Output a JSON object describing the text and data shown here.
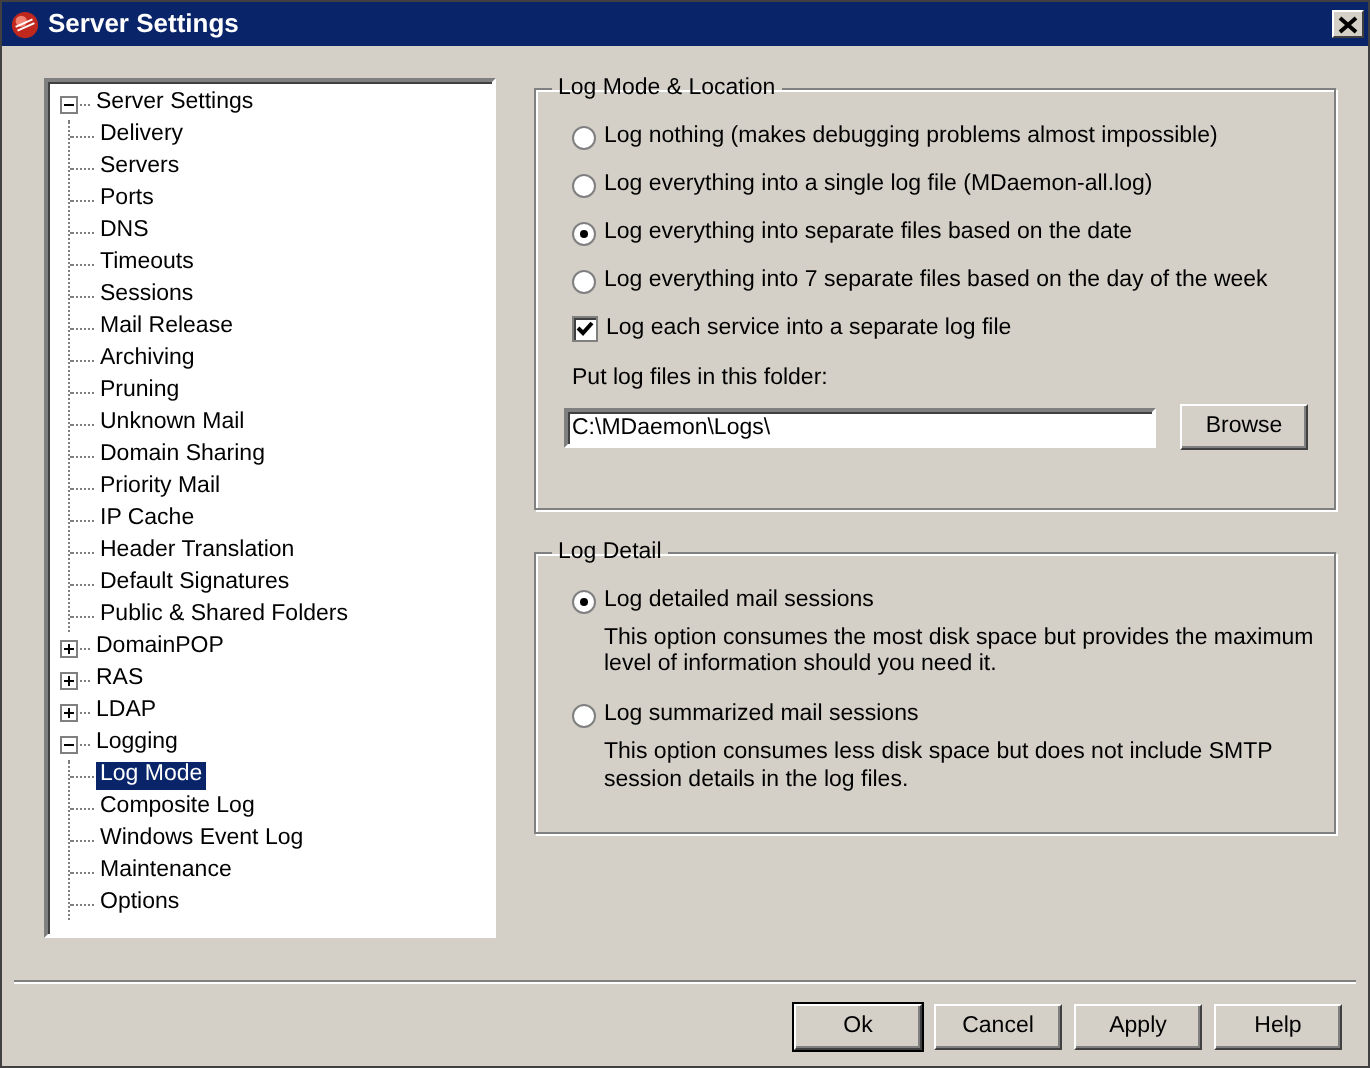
{
  "window": {
    "title": "Server Settings"
  },
  "tree": [
    {
      "label": "Server Settings",
      "expanded": true,
      "selected": false,
      "children": [
        {
          "label": "Delivery",
          "selected": false
        },
        {
          "label": "Servers",
          "selected": false
        },
        {
          "label": "Ports",
          "selected": false
        },
        {
          "label": "DNS",
          "selected": false
        },
        {
          "label": "Timeouts",
          "selected": false
        },
        {
          "label": "Sessions",
          "selected": false
        },
        {
          "label": "Mail Release",
          "selected": false
        },
        {
          "label": "Archiving",
          "selected": false
        },
        {
          "label": "Pruning",
          "selected": false
        },
        {
          "label": "Unknown Mail",
          "selected": false
        },
        {
          "label": "Domain Sharing",
          "selected": false
        },
        {
          "label": "Priority Mail",
          "selected": false
        },
        {
          "label": "IP Cache",
          "selected": false
        },
        {
          "label": "Header Translation",
          "selected": false
        },
        {
          "label": "Default Signatures",
          "selected": false
        },
        {
          "label": "Public & Shared Folders",
          "selected": false
        }
      ]
    },
    {
      "label": "DomainPOP",
      "expanded": false,
      "selected": false
    },
    {
      "label": "RAS",
      "expanded": false,
      "selected": false
    },
    {
      "label": "LDAP",
      "expanded": false,
      "selected": false
    },
    {
      "label": "Logging",
      "expanded": true,
      "selected": false,
      "children": [
        {
          "label": "Log Mode",
          "selected": true
        },
        {
          "label": "Composite Log",
          "selected": false
        },
        {
          "label": "Windows Event Log",
          "selected": false
        },
        {
          "label": "Maintenance",
          "selected": false
        },
        {
          "label": "Options",
          "selected": false
        }
      ]
    }
  ],
  "log_mode": {
    "title": "Log Mode & Location",
    "options": [
      {
        "label": "Log nothing (makes debugging problems almost impossible)",
        "selected": false
      },
      {
        "label": "Log everything into a single log file (MDaemon-all.log)",
        "selected": false
      },
      {
        "label": "Log everything into separate files based on the date",
        "selected": true
      },
      {
        "label": "Log everything into 7 separate files based on the day of the week",
        "selected": false
      }
    ],
    "separate_service": {
      "label": "Log each service into a separate log file",
      "checked": true
    },
    "folder_label": "Put log files in this folder:",
    "folder": "C:\\MDaemon\\Logs\\",
    "browse": "Browse"
  },
  "log_detail": {
    "title": "Log Detail",
    "options": [
      {
        "label": "Log detailed mail sessions",
        "selected": true,
        "description": "This option consumes the most disk space but provides the maximum level of information should you need it."
      },
      {
        "label": "Log summarized mail sessions",
        "selected": false,
        "description": "This option consumes less disk space but does not include SMTP session details in the log files."
      }
    ]
  },
  "buttons": [
    "Ok",
    "Cancel",
    "Apply",
    "Help"
  ]
}
